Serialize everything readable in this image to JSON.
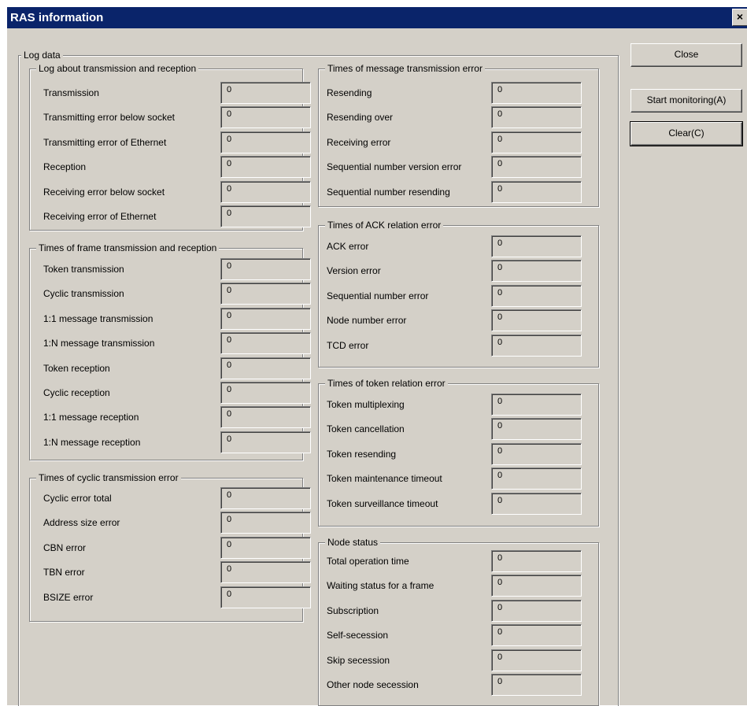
{
  "window": {
    "title": "RAS information",
    "close_glyph": "×"
  },
  "log_data_label": "Log data",
  "buttons": {
    "close": "Close",
    "start_monitoring": "Start monitoring(A)",
    "clear": "Clear(C)"
  },
  "groups": {
    "tx_rx": {
      "label": "Log about transmission and reception",
      "items": [
        {
          "label": "Transmission",
          "value": "0"
        },
        {
          "label": "Transmitting error below socket",
          "value": "0"
        },
        {
          "label": "Transmitting error of Ethernet",
          "value": "0"
        },
        {
          "label": "Reception",
          "value": "0"
        },
        {
          "label": "Receiving error below socket",
          "value": "0"
        },
        {
          "label": "Receiving error of Ethernet",
          "value": "0"
        }
      ]
    },
    "frame": {
      "label": "Times of frame transmission and reception",
      "items": [
        {
          "label": "Token transmission",
          "value": "0"
        },
        {
          "label": "Cyclic transmission",
          "value": "0"
        },
        {
          "label": "1:1 message transmission",
          "value": "0"
        },
        {
          "label": "1:N message transmission",
          "value": "0"
        },
        {
          "label": "Token reception",
          "value": "0"
        },
        {
          "label": "Cyclic reception",
          "value": "0"
        },
        {
          "label": "1:1 message reception",
          "value": "0"
        },
        {
          "label": "1:N message reception",
          "value": "0"
        }
      ]
    },
    "cyclic_err": {
      "label": "Times of cyclic transmission error",
      "items": [
        {
          "label": "Cyclic error total",
          "value": "0"
        },
        {
          "label": "Address size error",
          "value": "0"
        },
        {
          "label": "CBN error",
          "value": "0"
        },
        {
          "label": "TBN error",
          "value": "0"
        },
        {
          "label": "BSIZE error",
          "value": "0"
        }
      ]
    },
    "msg_err": {
      "label": "Times of message transmission error",
      "items": [
        {
          "label": "Resending",
          "value": "0"
        },
        {
          "label": "Resending over",
          "value": "0"
        },
        {
          "label": "Receiving error",
          "value": "0"
        },
        {
          "label": "Sequential number version error",
          "value": "0"
        },
        {
          "label": "Sequential number resending",
          "value": "0"
        }
      ]
    },
    "ack_err": {
      "label": "Times of ACK relation error",
      "items": [
        {
          "label": "ACK error",
          "value": "0"
        },
        {
          "label": "Version error",
          "value": "0"
        },
        {
          "label": "Sequential number error",
          "value": "0"
        },
        {
          "label": "Node number error",
          "value": "0"
        },
        {
          "label": "TCD error",
          "value": "0"
        }
      ]
    },
    "token_err": {
      "label": "Times of token relation error",
      "items": [
        {
          "label": "Token multiplexing",
          "value": "0"
        },
        {
          "label": "Token cancellation",
          "value": "0"
        },
        {
          "label": "Token resending",
          "value": "0"
        },
        {
          "label": "Token maintenance timeout",
          "value": "0"
        },
        {
          "label": "Token surveillance timeout",
          "value": "0"
        }
      ]
    },
    "node": {
      "label": "Node status",
      "items": [
        {
          "label": "Total operation time",
          "value": "0"
        },
        {
          "label": "Waiting status for a frame",
          "value": "0"
        },
        {
          "label": "Subscription",
          "value": "0"
        },
        {
          "label": "Self-secession",
          "value": "0"
        },
        {
          "label": "Skip secession",
          "value": "0"
        },
        {
          "label": "Other node secession",
          "value": "0"
        }
      ]
    }
  }
}
